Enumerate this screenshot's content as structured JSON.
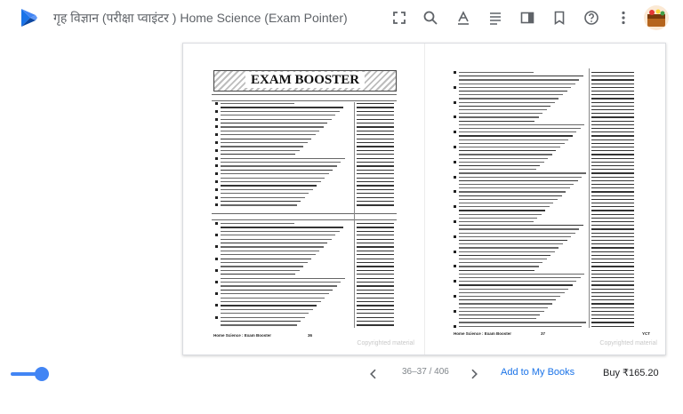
{
  "app": {
    "title": "गृह विज्ञान (परीक्षा प्वाइंटर ) Home Science (Exam Pointer)",
    "logo_icon": "play-books-icon",
    "accent": "#1a73e8"
  },
  "toolbar": {
    "icons": [
      "fullscreen-icon",
      "search-icon",
      "text-format-icon",
      "contents-icon",
      "display-mode-icon",
      "bookmark-icon",
      "help-icon",
      "more-icon"
    ]
  },
  "book": {
    "left_page": {
      "banner": "EXAM BOOSTER",
      "footer_left": "Home Science : Exam Booster",
      "footer_page": "36",
      "copyright": "Copyrighted material"
    },
    "right_page": {
      "footer_left": "Home Science : Exam Booster",
      "footer_page": "37",
      "footer_right": "YCT",
      "copyright": "Copyrighted material"
    }
  },
  "bottom": {
    "page_indicator": "36–37 / 406",
    "add_to_books": "Add to My Books",
    "buy": "Buy ₹165.20"
  }
}
